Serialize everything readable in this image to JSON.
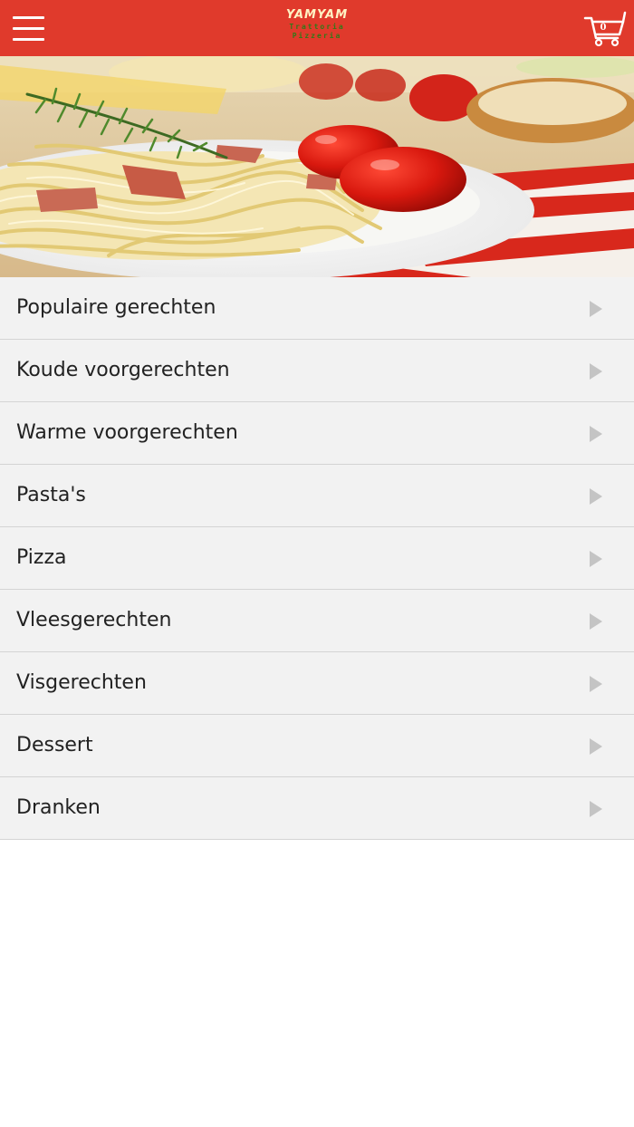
{
  "app": {
    "logo": {
      "line1": "YAMYAM",
      "line2": "Trattoria",
      "line3": "Pizzeria"
    },
    "cart_count": "0"
  },
  "colors": {
    "header_bg": "#e03a2c",
    "list_bg": "#f2f2f2",
    "divider": "#d4d4d4",
    "chevron": "#c4c4c4"
  },
  "icons": {
    "menu": "hamburger-icon",
    "cart": "shopping-cart-icon",
    "row": "chevron-right-icon"
  },
  "hero": {
    "image": "pasta-dish-photo"
  },
  "menu": {
    "items": [
      {
        "label": "Populaire gerechten"
      },
      {
        "label": "Koude voorgerechten"
      },
      {
        "label": "Warme voorgerechten"
      },
      {
        "label": "Pasta's"
      },
      {
        "label": "Pizza"
      },
      {
        "label": "Vleesgerechten"
      },
      {
        "label": "Visgerechten"
      },
      {
        "label": "Dessert"
      },
      {
        "label": "Dranken"
      }
    ]
  }
}
